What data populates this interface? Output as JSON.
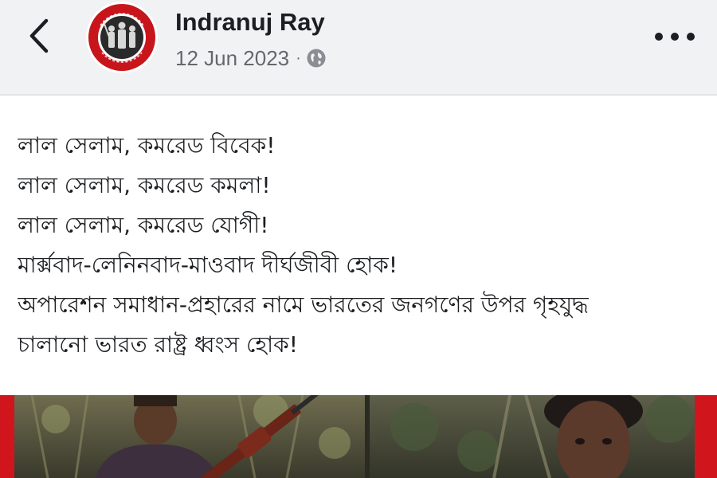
{
  "post": {
    "author": "Indranuj Ray",
    "date": "12 Jun 2023",
    "separator": "·",
    "privacy_icon": "globe-icon",
    "lines": [
      "লাল সেলাম, কমরেড বিবেক!",
      "লাল সেলাম, কমরেড কমলা!",
      "লাল সেলাম, কমরেড যোগী!",
      "মার্ক্সবাদ-লেনিনবাদ-মাওবাদ দীর্ঘজীবী হোক!",
      "অপারেশন সমাধান-প্রহারের নামে ভারতের জনগণের উপর গৃহযুদ্ধ",
      "চালানো ভারত রাষ্ট্র ধ্বংস হোক!"
    ]
  },
  "icons": {
    "back": "chevron-left-icon",
    "more": "more-dots-icon",
    "avatar": "red-circle-emblem"
  },
  "colors": {
    "header_bg": "#f1f2f4",
    "text": "#1c1e21",
    "meta": "#65676b",
    "avatar_red": "#c8151b",
    "media_border_red": "#d0161c"
  }
}
